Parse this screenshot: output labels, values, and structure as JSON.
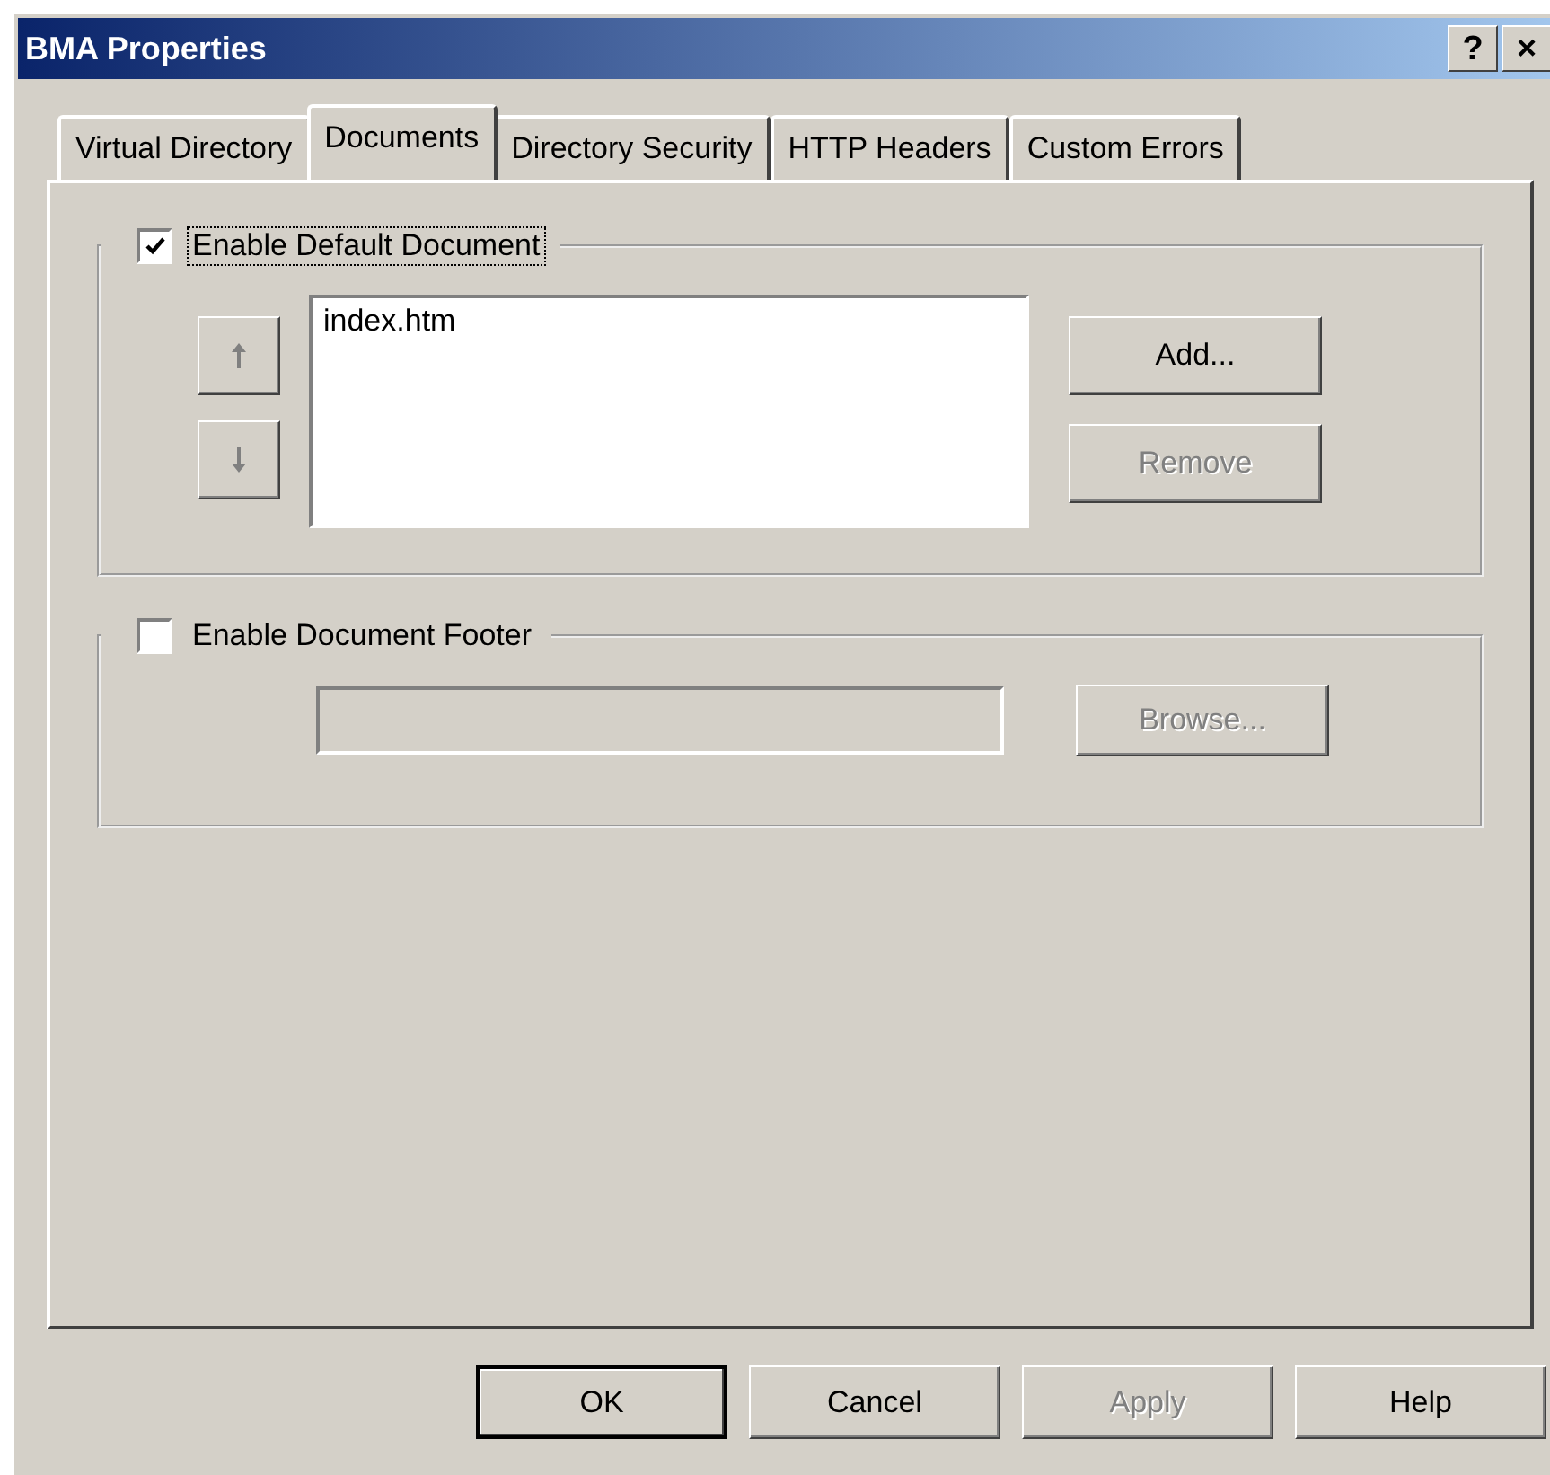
{
  "window": {
    "title": "BMA Properties",
    "title_buttons": [
      "?",
      "×"
    ]
  },
  "tabs": [
    {
      "label": "Virtual Directory",
      "selected": false
    },
    {
      "label": "Documents",
      "selected": true
    },
    {
      "label": "Directory Security",
      "selected": false
    },
    {
      "label": "HTTP Headers",
      "selected": false
    },
    {
      "label": "Custom Errors",
      "selected": false
    }
  ],
  "default_document": {
    "label": "Enable Default Document",
    "checked": true,
    "focused": true,
    "move_buttons": [
      {
        "kind": "up",
        "disabled": true
      },
      {
        "kind": "down",
        "disabled": true
      }
    ],
    "documents": [
      "index.htm"
    ],
    "buttons": [
      {
        "label": "Add...",
        "disabled": false
      },
      {
        "label": "Remove",
        "disabled": true
      }
    ]
  },
  "document_footer": {
    "label": "Enable Document Footer",
    "checked": false,
    "focused": false,
    "field_disabled": true,
    "browse_button": {
      "label": "Browse...",
      "disabled": true
    }
  },
  "dialog_buttons": [
    {
      "label": "OK",
      "default": true,
      "disabled": false
    },
    {
      "label": "Cancel",
      "default": false,
      "disabled": false
    },
    {
      "label": "Apply",
      "default": false,
      "disabled": true
    },
    {
      "label": "Help",
      "default": false,
      "disabled": false
    }
  ]
}
